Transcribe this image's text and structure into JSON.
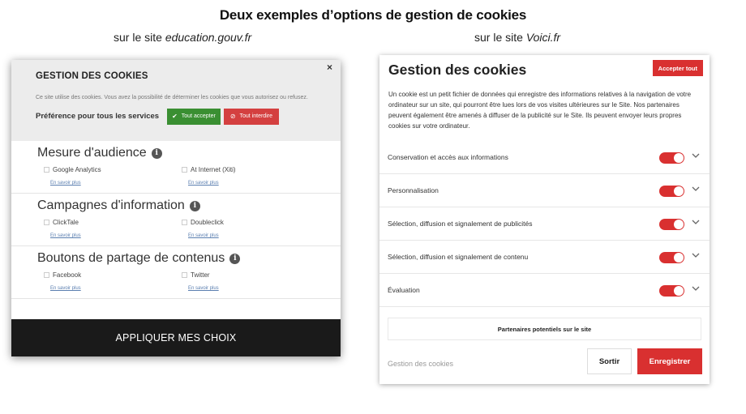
{
  "header": {
    "title": "Deux exemples d’options de gestion de cookies",
    "left_caption_prefix": "sur le site ",
    "left_caption_site": "education.gouv.fr",
    "right_caption_prefix": "sur le site ",
    "right_caption_site": "Voici.fr"
  },
  "left_panel": {
    "title": "GESTION DES COOKIES",
    "close": "×",
    "description": "Ce site utilise des cookies. Vous avez la possibilité de déterminer les cookies que vous autorisez ou refusez.",
    "preference_label": "Préférence pour tous les services",
    "accept_all": "Tout accepter",
    "deny_all": "Tout interdire",
    "sections": [
      {
        "title": "Mesure d'audience",
        "services": [
          {
            "name": "Google Analytics",
            "link": "En savoir plus"
          },
          {
            "name": "At Internet (Xiti)",
            "link": "En savoir plus"
          }
        ]
      },
      {
        "title": "Campagnes d'information",
        "services": [
          {
            "name": "ClickTale",
            "link": "En savoir plus"
          },
          {
            "name": "Doubleclick",
            "link": "En savoir plus"
          }
        ]
      },
      {
        "title": "Boutons de partage de contenus",
        "services": [
          {
            "name": "Facebook",
            "link": "En savoir plus"
          },
          {
            "name": "Twitter",
            "link": "En savoir plus"
          }
        ]
      }
    ],
    "apply": "APPLIQUER MES CHOIX"
  },
  "right_panel": {
    "title": "Gestion des cookies",
    "accept_all": "Accepter tout",
    "description": "Un cookie est un petit fichier de données qui enregistre des informations relatives à la navigation de votre ordinateur sur un site, qui pourront être lues lors de vos visites ultérieures sur le Site. Nos partenaires peuvent également être amenés à diffuser de la publicité sur le Site. Ils peuvent envoyer leurs propres cookies sur votre ordinateur.",
    "rows": [
      {
        "label": "Conservation et accès aux informations",
        "enabled": true
      },
      {
        "label": "Personnalisation",
        "enabled": true
      },
      {
        "label": "Sélection, diffusion et signalement de publicités",
        "enabled": true
      },
      {
        "label": "Sélection, diffusion et signalement de contenu",
        "enabled": true
      },
      {
        "label": "Évaluation",
        "enabled": true
      }
    ],
    "partners": "Partenaires potentiels sur le site",
    "footer_label": "Gestion des cookies",
    "exit": "Sortir",
    "save": "Enregistrer"
  },
  "colors": {
    "accent_red": "#d93030",
    "accept_green": "#3a8f32",
    "deny_red": "#d44040",
    "apply_bar": "#1a1a1a"
  }
}
